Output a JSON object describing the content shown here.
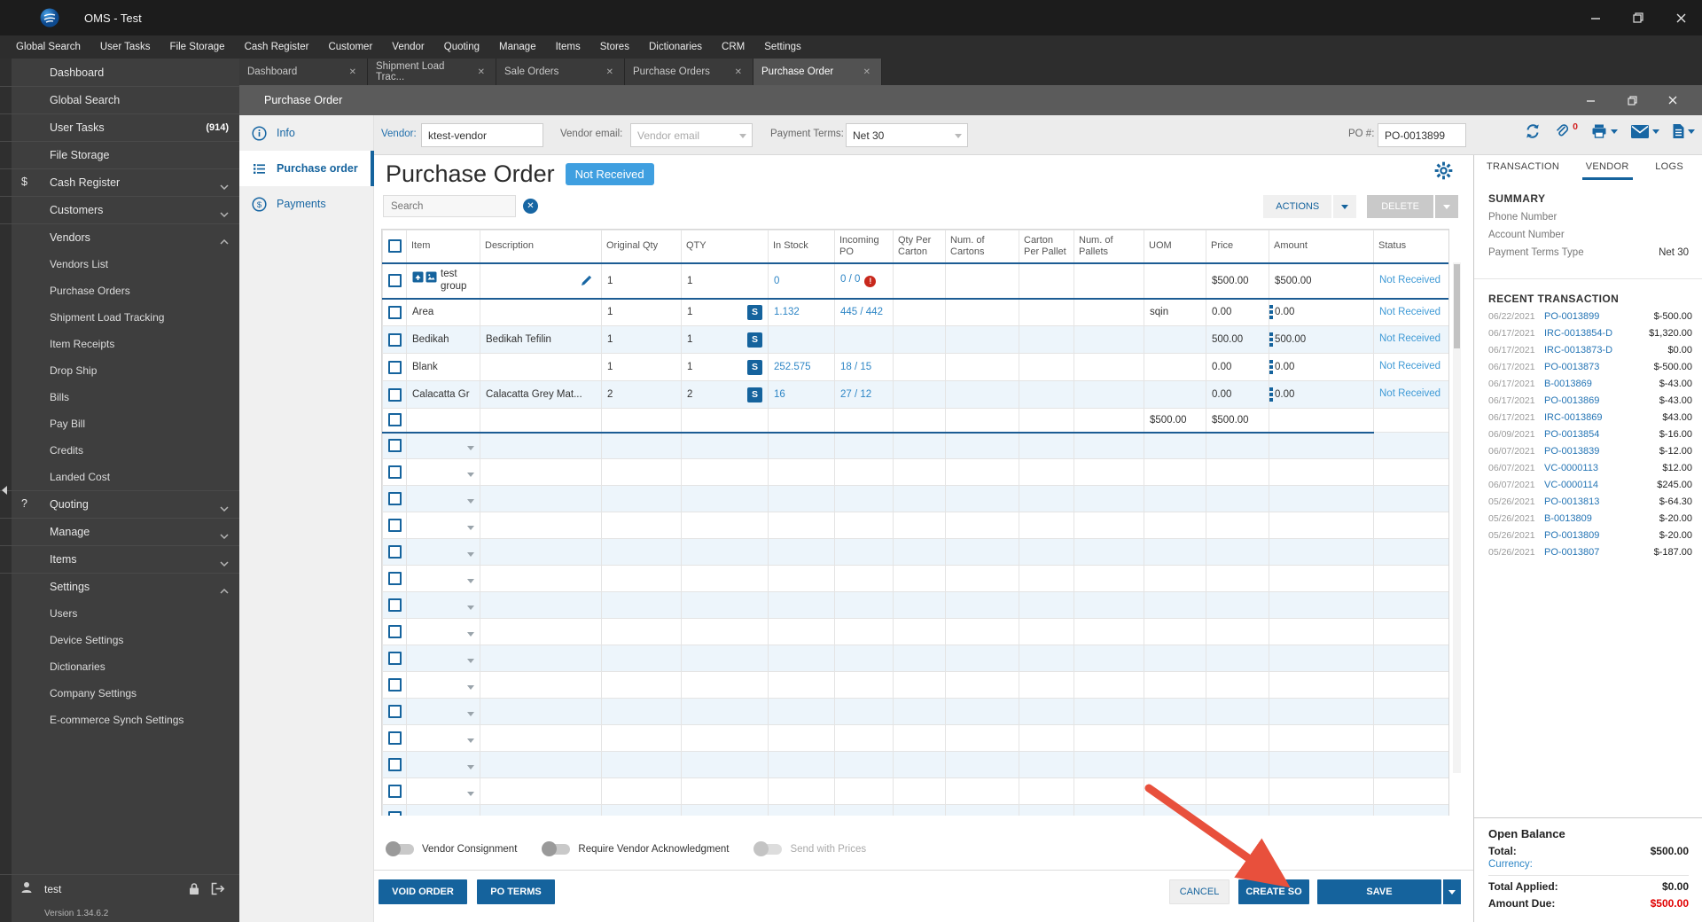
{
  "window": {
    "title": "OMS - Test"
  },
  "menu_bar": {
    "items": [
      "Global Search",
      "User Tasks",
      "File Storage",
      "Cash Register",
      "Customer",
      "Vendor",
      "Quoting",
      "Manage",
      "Items",
      "Stores",
      "Dictionaries",
      "CRM",
      "Settings"
    ]
  },
  "tabs": [
    {
      "label": "Dashboard",
      "active": false
    },
    {
      "label": "Shipment Load Trac...",
      "active": false
    },
    {
      "label": "Sale Orders",
      "active": false
    },
    {
      "label": "Purchase Orders",
      "active": false
    },
    {
      "label": "Purchase Order",
      "active": true
    }
  ],
  "sidebar": {
    "items": [
      {
        "label": "Dashboard",
        "icon": "dashboard-icon"
      },
      {
        "label": "Global Search",
        "icon": "search-icon"
      },
      {
        "label": "User Tasks",
        "icon": "tasks-icon",
        "badge": "(914)"
      },
      {
        "label": "File Storage",
        "icon": "folder-icon"
      },
      {
        "label": "Cash Register",
        "icon": "cash-icon",
        "chevron": "down"
      },
      {
        "label": "Customers",
        "icon": "person-icon",
        "chevron": "down"
      },
      {
        "label": "Vendors",
        "icon": "store-icon",
        "chevron": "up",
        "children": [
          "Vendors List",
          "Purchase Orders",
          "Shipment Load Tracking",
          "Item Receipts",
          "Drop Ship",
          "Bills",
          "Pay Bill",
          "Credits",
          "Landed Cost"
        ]
      },
      {
        "label": "Quoting",
        "icon": "quote-icon",
        "chevron": "down"
      },
      {
        "label": "Manage",
        "icon": "manage-icon",
        "chevron": "down"
      },
      {
        "label": "Items",
        "icon": "tag-icon",
        "chevron": "down"
      },
      {
        "label": "Settings",
        "icon": "gear-icon",
        "chevron": "up",
        "children": [
          "Users",
          "Device Settings",
          "Dictionaries",
          "Company Settings",
          "E-commerce Synch Settings"
        ]
      }
    ],
    "user": "test",
    "version": "Version 1.34.6.2"
  },
  "po_window": {
    "title": "Purchase Order",
    "form": {
      "vendor_label": "Vendor:",
      "vendor_value": "ktest-vendor",
      "vendor_email_label": "Vendor email:",
      "vendor_email_placeholder": "Vendor email",
      "payment_terms_label": "Payment Terms:",
      "payment_terms_value": "Net 30",
      "po_number_label": "PO #:",
      "po_number_value": "PO-0013899"
    },
    "subnav": [
      {
        "label": "Info",
        "active": false
      },
      {
        "label": "Purchase order",
        "active": true
      },
      {
        "label": "Payments",
        "active": false
      }
    ],
    "heading": "Purchase Order",
    "status_badge": "Not Received",
    "search_placeholder": "Search",
    "actions_button": "ACTIONS",
    "delete_button": "DELETE",
    "table": {
      "headers": [
        "Item",
        "Description",
        "Original Qty",
        "QTY",
        "In Stock",
        "Incoming PO",
        "Qty Per Carton",
        "Num. of Cartons",
        "Carton Per Pallet",
        "Num. of Pallets",
        "UOM",
        "Price",
        "Amount",
        "Status"
      ],
      "rows": [
        {
          "type": "group",
          "item": "test group",
          "description": "",
          "original_qty": "1",
          "qty": "1",
          "in_stock": "0",
          "incoming_po": "0 / 0",
          "uom": "",
          "price": "$500.00",
          "amount": "$500.00",
          "status": "Not Received"
        },
        {
          "type": "line",
          "item": "Area",
          "description": "",
          "original_qty": "1",
          "qty": "1",
          "in_stock": "1.132",
          "incoming_po": "445 / 442",
          "uom": "sqin",
          "price": "0.00",
          "amount": "0.00",
          "status": "Not Received"
        },
        {
          "type": "line",
          "item": "Bedikah",
          "description": "Bedikah Tefilin",
          "original_qty": "1",
          "qty": "1",
          "in_stock": "",
          "incoming_po": "",
          "uom": "",
          "price": "500.00",
          "amount": "500.00",
          "status": "Not Received"
        },
        {
          "type": "line",
          "item": "Blank",
          "description": "",
          "original_qty": "1",
          "qty": "1",
          "in_stock": "252.575",
          "incoming_po": "18 / 15",
          "uom": "",
          "price": "0.00",
          "amount": "0.00",
          "status": "Not Received"
        },
        {
          "type": "line",
          "item": "Calacatta Gr",
          "description": "Calacatta Grey Mat...",
          "original_qty": "2",
          "qty": "2",
          "in_stock": "16",
          "incoming_po": "27 / 12",
          "uom": "",
          "price": "0.00",
          "amount": "0.00",
          "status": "Not Received"
        },
        {
          "type": "totals",
          "price": "$500.00",
          "amount": "$500.00"
        }
      ],
      "empty_row_count": 15
    },
    "toggles": [
      {
        "label": "Vendor Consignment",
        "on": false,
        "disabled": false
      },
      {
        "label": "Require Vendor Acknowledgment",
        "on": false,
        "disabled": false
      },
      {
        "label": "Send with Prices",
        "on": false,
        "disabled": true
      }
    ],
    "footer_buttons": {
      "void_order": "VOID ORDER",
      "po_terms": "PO TERMS",
      "cancel": "CANCEL",
      "create_so": "CREATE SO",
      "save": "SAVE"
    }
  },
  "right_panel": {
    "attachment_count": "0",
    "tabs": [
      {
        "label": "TRANSACTION",
        "active": false
      },
      {
        "label": "VENDOR",
        "active": true
      },
      {
        "label": "LOGS",
        "active": false
      }
    ],
    "summary": {
      "title": "SUMMARY",
      "rows": [
        {
          "label": "Phone Number",
          "value": ""
        },
        {
          "label": "Account Number",
          "value": ""
        },
        {
          "label": "Payment Terms Type",
          "value": "Net 30"
        }
      ]
    },
    "recent_transactions": {
      "title": "RECENT TRANSACTION",
      "rows": [
        {
          "date": "06/22/2021",
          "doc": "PO-0013899",
          "amount": "$-500.00"
        },
        {
          "date": "06/17/2021",
          "doc": "IRC-0013854-D",
          "amount": "$1,320.00"
        },
        {
          "date": "06/17/2021",
          "doc": "IRC-0013873-D",
          "amount": "$0.00"
        },
        {
          "date": "06/17/2021",
          "doc": "PO-0013873",
          "amount": "$-500.00"
        },
        {
          "date": "06/17/2021",
          "doc": "B-0013869",
          "amount": "$-43.00"
        },
        {
          "date": "06/17/2021",
          "doc": "PO-0013869",
          "amount": "$-43.00"
        },
        {
          "date": "06/17/2021",
          "doc": "IRC-0013869",
          "amount": "$43.00"
        },
        {
          "date": "06/09/2021",
          "doc": "PO-0013854",
          "amount": "$-16.00"
        },
        {
          "date": "06/07/2021",
          "doc": "PO-0013839",
          "amount": "$-12.00"
        },
        {
          "date": "06/07/2021",
          "doc": "VC-0000113",
          "amount": "$12.00"
        },
        {
          "date": "06/07/2021",
          "doc": "VC-0000114",
          "amount": "$245.00"
        },
        {
          "date": "05/26/2021",
          "doc": "PO-0013813",
          "amount": "$-64.30"
        },
        {
          "date": "05/26/2021",
          "doc": "B-0013809",
          "amount": "$-20.00"
        },
        {
          "date": "05/26/2021",
          "doc": "PO-0013809",
          "amount": "$-20.00"
        },
        {
          "date": "05/26/2021",
          "doc": "PO-0013807",
          "amount": "$-187.00"
        }
      ]
    },
    "open_balance": {
      "title": "Open Balance",
      "total_label": "Total:",
      "total_value": "$500.00",
      "currency_label": "Currency:",
      "total_applied_label": "Total Applied:",
      "total_applied_value": "$0.00",
      "amount_due_label": "Amount Due:",
      "amount_due_value": "$500.00"
    }
  },
  "colors": {
    "accent_blue": "#15639d",
    "badge_blue": "#3f9fe0",
    "link_blue": "#2e86c6",
    "status_blue": "#3f9ad6",
    "error_red": "#d21e1e",
    "arrow_red": "#e8503c"
  }
}
